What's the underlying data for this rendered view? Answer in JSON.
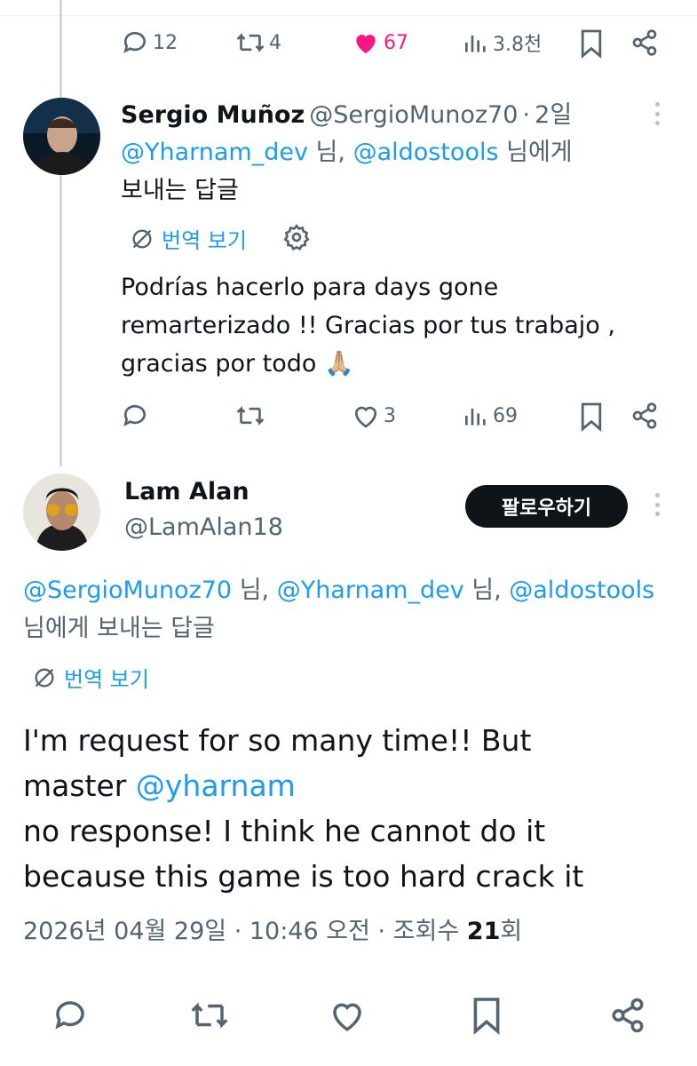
{
  "top_actions": {
    "replies": "12",
    "retweets": "4",
    "likes": "67",
    "views": "3.8천"
  },
  "reply1": {
    "name": "Sergio Muñoz",
    "handle": "@SergioMunoz70",
    "sep": "·",
    "time": "2일",
    "mention1": "@Yharnam_dev",
    "suffix1": " 님,",
    "mention2": "@aldostools",
    "suffix2": " 님에게",
    "reply_line2": "보내는 답글",
    "translate": "번역 보기",
    "text_line1": "Podrías hacerlo para days gone",
    "text_line2": "remarterizado !! Gracias por tus trabajo ,",
    "text_line3": "gracias por todo 🙏🏼",
    "likes": "3",
    "views": "69"
  },
  "reply2": {
    "name": "Lam Alan",
    "handle": "@LamAlan18",
    "follow": "팔로우하기",
    "mention1": "@SergioMunoz70",
    "sep1": " 님, ",
    "mention2": "@Yharnam_dev",
    "sep2": " 님, ",
    "mention3": "@aldostools",
    "reply_line2": "님에게 보내는 답글",
    "translate": "번역 보기",
    "text_line1": "I'm request for so many time!! But",
    "text_line2_prefix": "master ",
    "text_line2_mention": "@yharnam",
    "text_line3": "no response! I think he cannot do it",
    "text_line4": "because this game is too hard crack it",
    "meta_prefix": "2026년 04월 29일 · 10:46 오전 · 조회수 ",
    "meta_count": "21",
    "meta_suffix": "회"
  },
  "colors": {
    "link": "#1d9bf0",
    "like": "#f91880",
    "muted": "#536471",
    "button": "#0f1419"
  },
  "icons": [
    "reply-icon",
    "retweet-icon",
    "heart-icon",
    "views-icon",
    "bookmark-icon",
    "share-icon",
    "translate-icon",
    "gear-icon",
    "more-icon",
    "pray-emoji"
  ]
}
